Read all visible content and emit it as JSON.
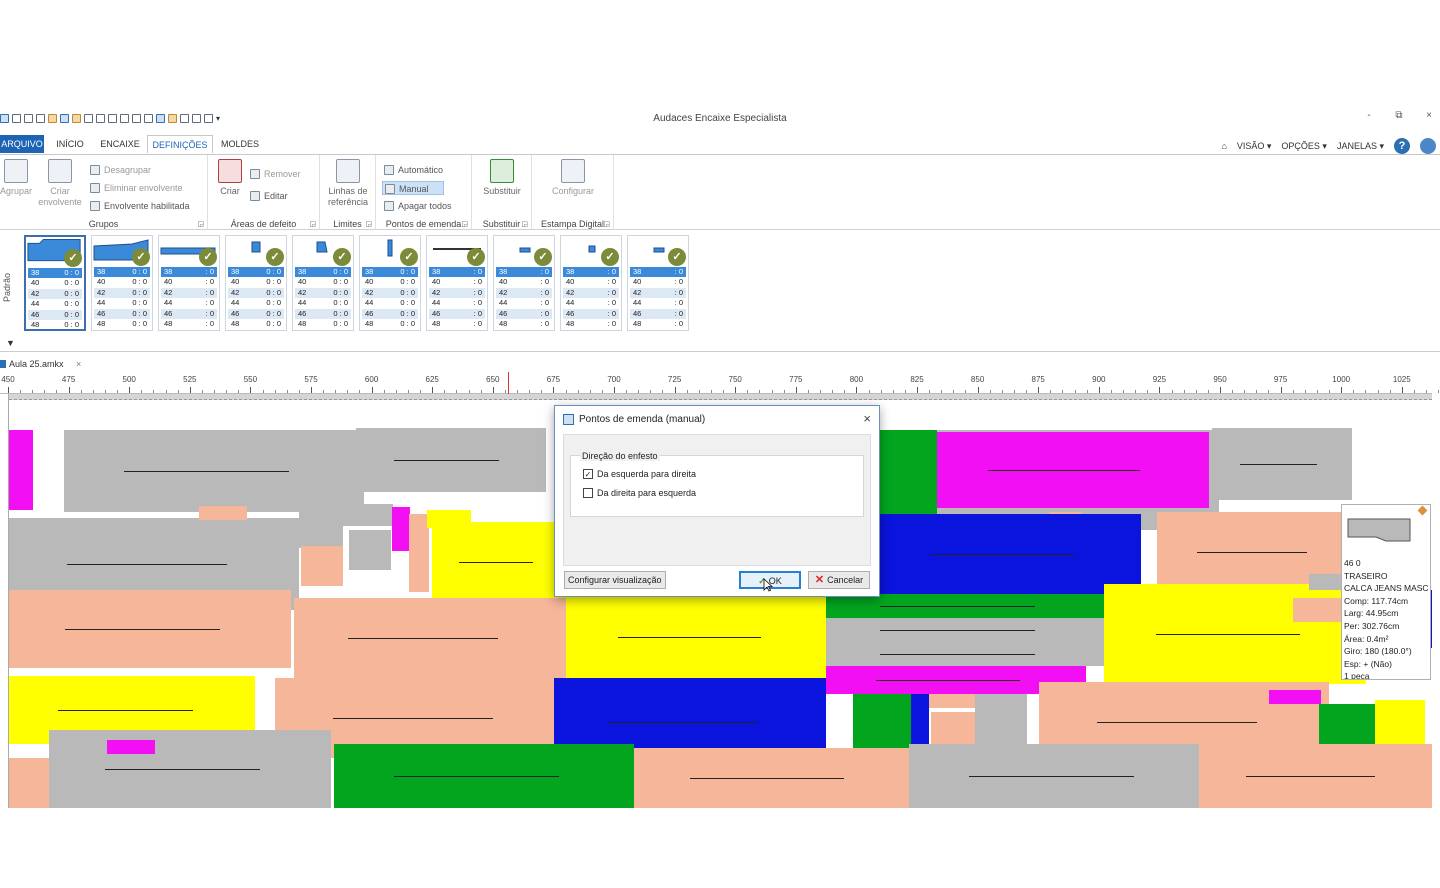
{
  "window": {
    "title": "Audaces Encaixe Especialista",
    "controls": {
      "minimize": "-",
      "restore": "⧉",
      "close": "×"
    }
  },
  "tabs": [
    {
      "label": "ARQUIVO"
    },
    {
      "label": "INÍCIO"
    },
    {
      "label": "ENCAIXE"
    },
    {
      "label": "DEFINIÇÕES"
    },
    {
      "label": "MOLDES"
    }
  ],
  "right_menu": {
    "visao": "VISÃO ▾",
    "opcoes": "OPÇÕES ▾",
    "janelas": "JANELAS ▾",
    "help": "?"
  },
  "ribbon": {
    "grupos": {
      "label": "Grupos",
      "agrupar": "Agrupar",
      "criar_envolvente": "Criar envolvente",
      "desagrupar": "Desagrupar",
      "eliminar_envolvente": "Eliminar envolvente",
      "envolvente_habilitada": "Envolvente habilitada"
    },
    "areas": {
      "label": "Áreas de defeito",
      "criar": "Criar",
      "remover": "Remover",
      "editar": "Editar"
    },
    "limites": {
      "label": "Limites",
      "linhas_referencia": "Linhas de referência"
    },
    "pontos": {
      "label": "Pontos de emenda",
      "automatico": "Automático",
      "manual": "Manual",
      "apagar_todos": "Apagar todos"
    },
    "substituir": {
      "label": "Substituir",
      "btn": "Substituir"
    },
    "estampa": {
      "label": "Estampa Digital",
      "btn": "Configurar"
    }
  },
  "strip": {
    "padrao_label": "Padrão",
    "cards": [
      {
        "rows": [
          [
            "38",
            "0 : 0"
          ],
          [
            "40",
            "0 : 0"
          ],
          [
            "42",
            "0 : 0"
          ],
          [
            "44",
            "0 : 0"
          ],
          [
            "46",
            "0 : 0"
          ],
          [
            "48",
            "0 : 0"
          ]
        ]
      },
      {
        "rows": [
          [
            "38",
            "0 : 0"
          ],
          [
            "40",
            "0 : 0"
          ],
          [
            "42",
            "0 : 0"
          ],
          [
            "44",
            "0 : 0"
          ],
          [
            "46",
            "0 : 0"
          ],
          [
            "48",
            "0 : 0"
          ]
        ]
      },
      {
        "rows": [
          [
            "38",
            ": 0"
          ],
          [
            "40",
            ": 0"
          ],
          [
            "42",
            ": 0"
          ],
          [
            "44",
            ": 0"
          ],
          [
            "46",
            ": 0"
          ],
          [
            "48",
            ": 0"
          ]
        ]
      },
      {
        "rows": [
          [
            "38",
            "0 : 0"
          ],
          [
            "40",
            "0 : 0"
          ],
          [
            "42",
            "0 : 0"
          ],
          [
            "44",
            "0 : 0"
          ],
          [
            "46",
            "0 : 0"
          ],
          [
            "48",
            "0 : 0"
          ]
        ]
      },
      {
        "rows": [
          [
            "38",
            "0 : 0"
          ],
          [
            "40",
            "0 : 0"
          ],
          [
            "42",
            "0 : 0"
          ],
          [
            "44",
            "0 : 0"
          ],
          [
            "46",
            "0 : 0"
          ],
          [
            "48",
            "0 : 0"
          ]
        ]
      },
      {
        "rows": [
          [
            "38",
            "0 : 0"
          ],
          [
            "40",
            "0 : 0"
          ],
          [
            "42",
            "0 : 0"
          ],
          [
            "44",
            "0 : 0"
          ],
          [
            "46",
            "0 : 0"
          ],
          [
            "48",
            "0 : 0"
          ]
        ]
      },
      {
        "rows": [
          [
            "38",
            ": 0"
          ],
          [
            "40",
            ": 0"
          ],
          [
            "42",
            ": 0"
          ],
          [
            "44",
            ": 0"
          ],
          [
            "46",
            ": 0"
          ],
          [
            "48",
            ": 0"
          ]
        ]
      },
      {
        "rows": [
          [
            "38",
            ": 0"
          ],
          [
            "40",
            ": 0"
          ],
          [
            "42",
            ": 0"
          ],
          [
            "44",
            ": 0"
          ],
          [
            "46",
            ": 0"
          ],
          [
            "48",
            ": 0"
          ]
        ]
      },
      {
        "rows": [
          [
            "38",
            ": 0"
          ],
          [
            "40",
            ": 0"
          ],
          [
            "42",
            ": 0"
          ],
          [
            "44",
            ": 0"
          ],
          [
            "46",
            ": 0"
          ],
          [
            "48",
            ": 0"
          ]
        ]
      },
      {
        "rows": [
          [
            "38",
            ": 0"
          ],
          [
            "40",
            ": 0"
          ],
          [
            "42",
            ": 0"
          ],
          [
            "44",
            ": 0"
          ],
          [
            "46",
            ": 0"
          ],
          [
            "48",
            ": 0"
          ]
        ]
      }
    ]
  },
  "document": {
    "tab": "Aula 25.amkx",
    "close": "×"
  },
  "ruler": {
    "labels": [
      "450",
      "475",
      "500",
      "525",
      "550",
      "575",
      "600",
      "625",
      "650",
      "675",
      "700",
      "725",
      "750",
      "775",
      "800",
      "825",
      "850",
      "875",
      "900",
      "925",
      "950",
      "975",
      "1000",
      "1025"
    ]
  },
  "info_panel": {
    "lines": [
      "46            0",
      "TRASEIRO",
      "CALCA JEANS MASC",
      "Comp: 117.74cm",
      "Larg: 44.95cm",
      "Per: 302.76cm",
      "Área: 0.4m²",
      "Giro: 180  (180.0°)",
      "Esp: +  (Não)",
      "1 peça"
    ]
  },
  "dialog": {
    "title": "Pontos de emenda (manual)",
    "close": "×",
    "group": "Direção do enfesto",
    "opt1": {
      "label": "Da esquerda para direita",
      "checked": "✓"
    },
    "opt2": {
      "label": "Da direita para esquerda",
      "checked": ""
    },
    "configurar": "Configurar visualização",
    "ok": "OK",
    "ok_check": "✓",
    "cancelar": "Cancelar",
    "cancel_x": "✕"
  },
  "colors": {
    "accent": "#1e64b4",
    "gray": "#b9b9b9",
    "pink": "#f5b69a",
    "yellow": "#ffff00",
    "blue": "#0a14dc",
    "green": "#03a51f",
    "magenta": "#f30ff3"
  }
}
